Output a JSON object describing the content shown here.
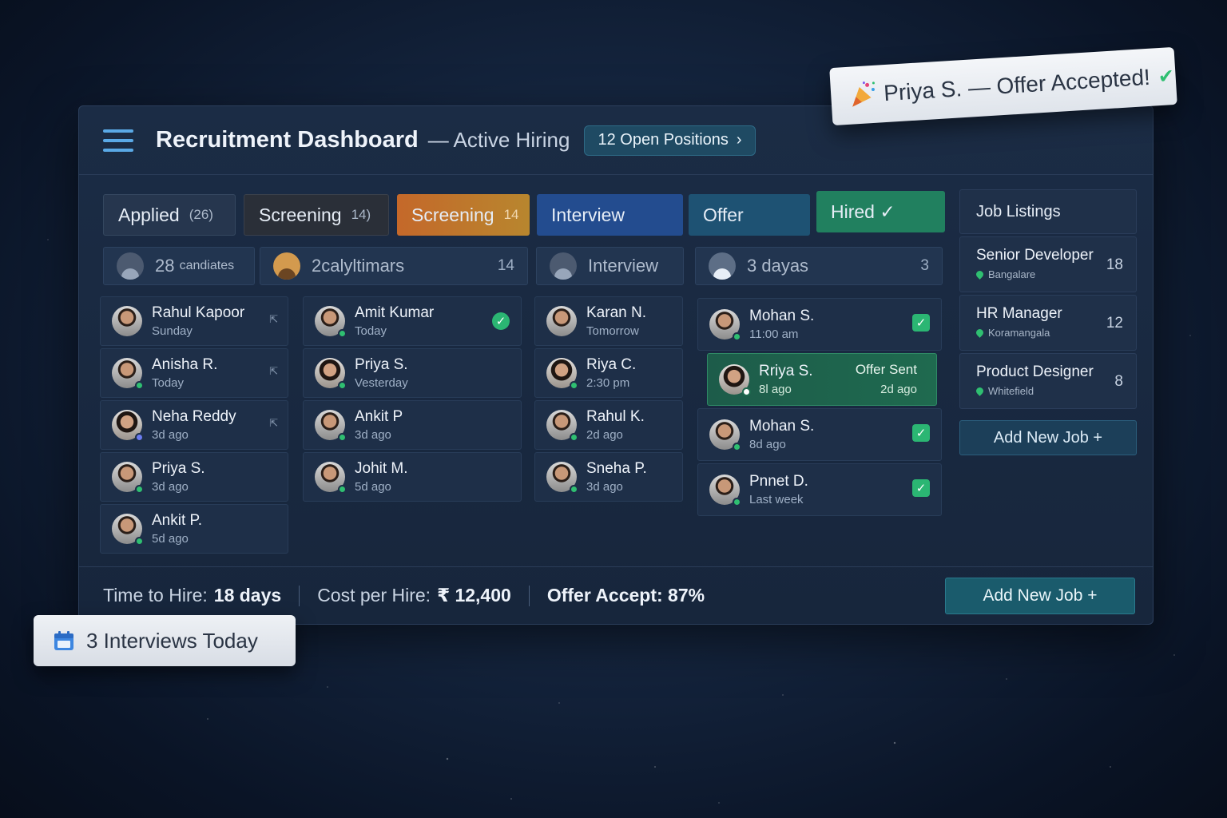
{
  "toast": {
    "text": "Priya S. — Offer Accepted!",
    "icon": "party-popper-icon"
  },
  "header": {
    "title": "Recruitment Dashboard",
    "subtitle": "— Active Hiring",
    "open_positions": "12 Open Positions"
  },
  "tabs": [
    {
      "label": "Applied",
      "count": "(26)"
    },
    {
      "label": "Screening",
      "count": "14)"
    },
    {
      "label": "Screening",
      "count": "14"
    },
    {
      "label": "Interview",
      "count": ""
    },
    {
      "label": "Offer",
      "count": ""
    },
    {
      "label": "Hired ✓",
      "count": ""
    }
  ],
  "summaries": [
    {
      "label": "28",
      "small": "candiates",
      "count": ""
    },
    {
      "label": "2calyltimars",
      "small": "",
      "count": "14"
    },
    {
      "label": "Interview",
      "small": "",
      "count": ""
    },
    {
      "label": "3 dayas",
      "small": "",
      "count": "3"
    }
  ],
  "columns": {
    "applied": [
      {
        "name": "Rahul Kapoor",
        "time": "Sunday"
      },
      {
        "name": "Anisha R.",
        "time": "Today"
      },
      {
        "name": "Neha Reddy",
        "time": "3d ago"
      },
      {
        "name": "Priya S.",
        "time": "3d ago"
      },
      {
        "name": "Ankit P.",
        "time": "5d ago"
      }
    ],
    "screening": [
      {
        "name": "Amit Kumar",
        "time": "Today"
      },
      {
        "name": "Priya S.",
        "time": "Vesterday"
      },
      {
        "name": "Ankit P",
        "time": "3d ago"
      },
      {
        "name": "Johit M.",
        "time": "5d ago"
      }
    ],
    "interview": [
      {
        "name": "Karan N.",
        "time": "Tomorrow"
      },
      {
        "name": "Riya C.",
        "time": "2:30 pm"
      },
      {
        "name": "Rahul K.",
        "time": "2d ago"
      },
      {
        "name": "Sneha P.",
        "time": "3d ago"
      }
    ],
    "offer": [
      {
        "name": "Mohan S.",
        "time": "11:00 am"
      },
      {
        "name": "Rriya S.",
        "time": "8l ago",
        "status": "Offer Sent",
        "status_time": "2d ago"
      },
      {
        "name": "Mohan S.",
        "time": "8d ago"
      },
      {
        "name": "Pnnet D.",
        "time": "Last week"
      }
    ]
  },
  "jobs": {
    "header": "Job Listings",
    "items": [
      {
        "title": "Senior Developer",
        "location": "Bangalare",
        "count": "18"
      },
      {
        "title": "HR Manager",
        "location": "Koramangala",
        "count": "12"
      },
      {
        "title": "Product Designer",
        "location": "Whitefield",
        "count": "8"
      }
    ],
    "add_label": "Add New Job +"
  },
  "footer": {
    "time_label": "Time to Hire:",
    "time_value": "18 days",
    "cost_label": "Cost per Hire:",
    "cost_value": "₹ 12,400",
    "offer_label": "Offer Accept: 87%",
    "add_label": "Add New Job +"
  },
  "badge": {
    "text": "3 Interviews Today"
  }
}
